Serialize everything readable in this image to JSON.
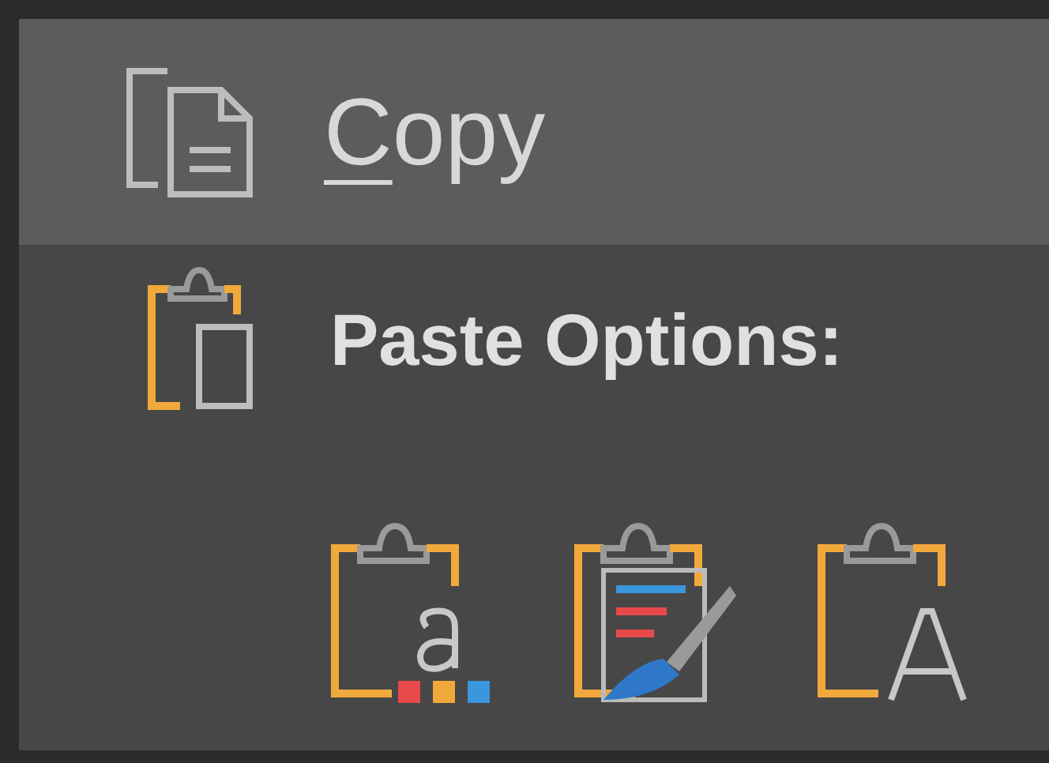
{
  "menu": [
    {
      "kind": "command",
      "label": "Copy",
      "access_key_underlined": true,
      "highlighted": true
    },
    {
      "kind": "heading",
      "label": "Paste Options:",
      "highlighted": false
    }
  ],
  "paste_options": [
    {
      "kind": "keep-source"
    },
    {
      "kind": "merge"
    },
    {
      "kind": "text-only"
    }
  ]
}
